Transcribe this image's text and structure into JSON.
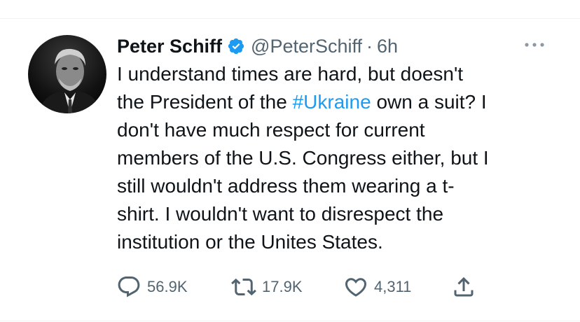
{
  "tweet": {
    "author_name": "Peter Schiff",
    "handle": "@PeterSchiff",
    "separator": "·",
    "time": "6h",
    "text_lines": [
      "I understand times are hard, but doesn't",
      "the President of the ",
      "#Ukraine",
      " own a suit? I",
      "don't have much respect for current",
      "members of the U.S. Congress either, but I",
      "still wouldn't address them wearing a t-",
      "shirt. I wouldn't want to disrespect the",
      "institution or the Unites States."
    ]
  },
  "actions": {
    "replies": "56.9K",
    "retweets": "17.9K",
    "likes": "4,311"
  },
  "icons": {
    "verified": "verified-badge-icon",
    "more": "more-horizontal-icon",
    "reply": "reply-icon",
    "retweet": "retweet-icon",
    "like": "like-icon",
    "share": "share-icon"
  },
  "colors": {
    "text": "#0f1419",
    "secondary": "#536471",
    "accent": "#1d9bf0"
  }
}
